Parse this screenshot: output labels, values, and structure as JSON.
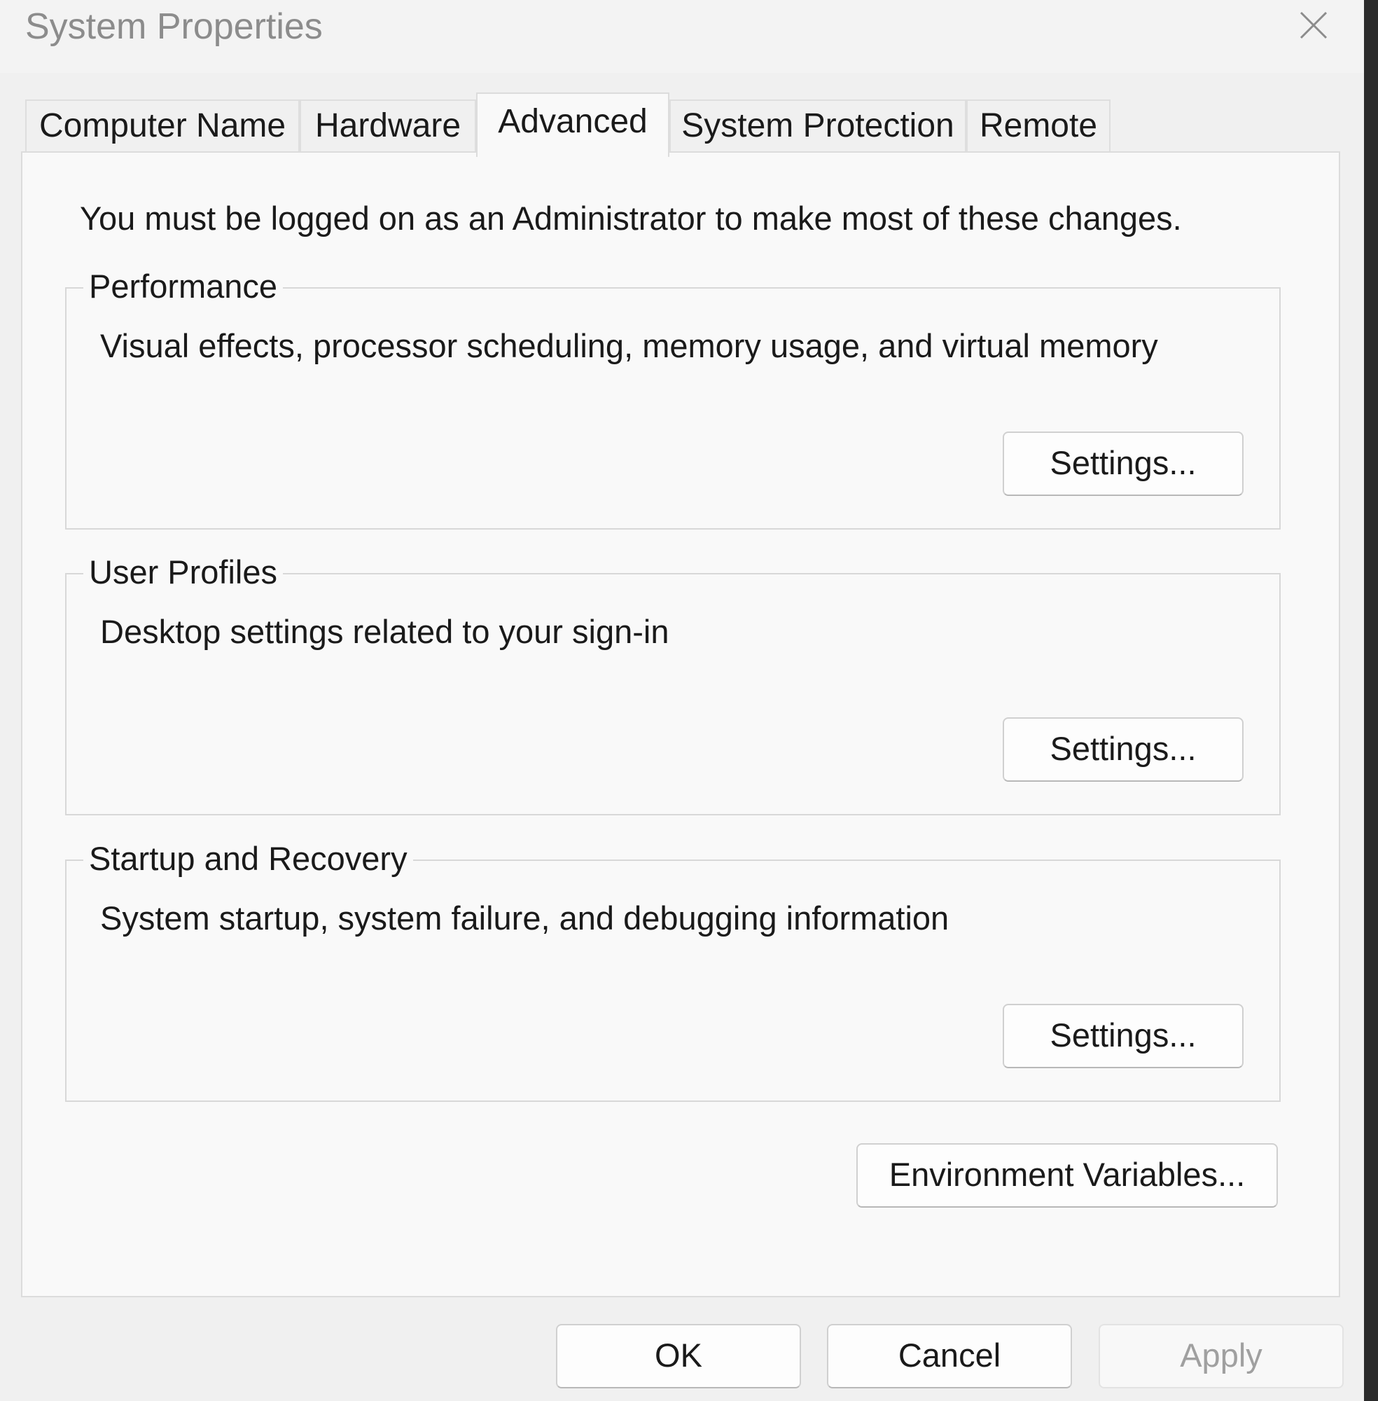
{
  "window": {
    "title": "System Properties",
    "close_icon": "close-icon"
  },
  "tabs": [
    {
      "label": "Computer Name",
      "active": false
    },
    {
      "label": "Hardware",
      "active": false
    },
    {
      "label": "Advanced",
      "active": true
    },
    {
      "label": "System Protection",
      "active": false
    },
    {
      "label": "Remote",
      "active": false
    }
  ],
  "notice": "You must be logged on as an Administrator to make most of these changes.",
  "groups": {
    "performance": {
      "title": "Performance",
      "description": "Visual effects, processor scheduling, memory usage, and virtual memory",
      "button_label": "Settings..."
    },
    "user_profiles": {
      "title": "User Profiles",
      "description": "Desktop settings related to your sign-in",
      "button_label": "Settings..."
    },
    "startup_recovery": {
      "title": "Startup and Recovery",
      "description": "System startup, system failure, and debugging information",
      "button_label": "Settings..."
    }
  },
  "environment_button": "Environment Variables...",
  "footer": {
    "ok_label": "OK",
    "cancel_label": "Cancel",
    "apply_label": "Apply",
    "apply_disabled": true
  },
  "colors": {
    "dialog_bg": "#f0f0f0",
    "panel_bg": "#f9f9f9",
    "title_text": "#8c8c8c",
    "disabled_text": "#a0a0a0"
  }
}
